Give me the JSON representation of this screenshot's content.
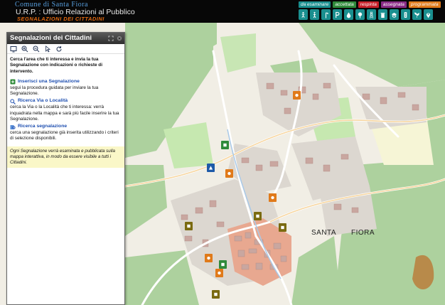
{
  "header": {
    "town": "Comune di Santa Fiora",
    "office": "U.R.P. : Ufficio Relazioni al Pubblico",
    "section": "SEGNALAZIONI DEI CITTADINI",
    "status_tabs": [
      {
        "label": "da esaminare",
        "color": "#1a8f8f"
      },
      {
        "label": "accettata",
        "color": "#2f8a3a"
      },
      {
        "label": "respinta",
        "color": "#c8202a"
      },
      {
        "label": "assegnata",
        "color": "#8a2b86"
      },
      {
        "label": "programmata",
        "color": "#e07a1a"
      }
    ],
    "category_icons": [
      "accessibility-icon",
      "pedestrian-icon",
      "streetlight-icon",
      "parking-icon",
      "water-icon",
      "tree-icon",
      "road-icon",
      "waste-icon",
      "school-icon",
      "traffic-icon",
      "garden-icon",
      "pin-icon"
    ]
  },
  "panel": {
    "title": "Segnalazioni dei Cittadini",
    "tools": [
      "zoom-extent-icon",
      "zoom-in-icon",
      "zoom-out-icon",
      "pointer-icon",
      "refresh-icon"
    ],
    "intro": "Cerca l'area che ti interessa e invia la tua Segnalazione con indicazioni o richieste di intervento.",
    "sections": [
      {
        "icon": "insert-icon",
        "title": "Inserisci una Segnalazione",
        "text": "segui la procedura guidata per inviare la tua Segnalazione."
      },
      {
        "icon": "search-icon",
        "title": "Ricerca Via o Località",
        "text": "cerca la Via o la Località che ti interessa: verrà inquadrata nella mappa e sarà più facile inserire la tua Segnalazione."
      },
      {
        "icon": "find-report-icon",
        "title": "Ricerca segnalazione",
        "text": "cerca una segnalazione già inserita utilizzando i criteri di selezione disponibili."
      }
    ],
    "note": "Ogni Segnalazione verrà esaminata e pubblicata sulla mappa interattiva, in modo da essere visibile a tutti i Cittadini."
  },
  "map": {
    "labels": [
      {
        "text": "SANTA",
        "size": "big"
      },
      {
        "text": "FIORA",
        "size": "big"
      }
    ]
  }
}
